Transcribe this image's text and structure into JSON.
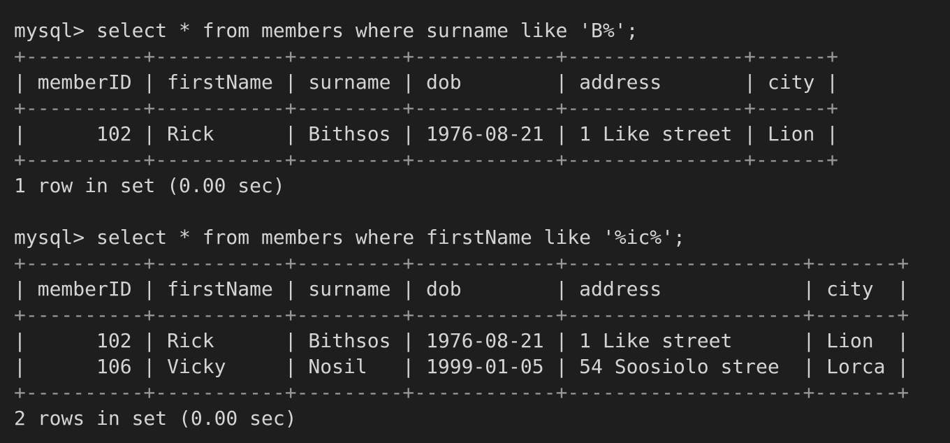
{
  "terminal": {
    "background": "#1e1e1e",
    "text_color": "#d4d4d4",
    "lines": [
      "mysql> select * from members where surname like 'B%';",
      "+----------+-----------+---------+------------+---------------+------+",
      "| memberID | firstName | surname | dob        | address       | city |",
      "+----------+-----------+---------+------------+---------------+------+",
      "|      102 | Rick      | Bithsos | 1976-08-21 | 1 Like street | Lion |",
      "+----------+-----------+---------+------------+---------------+------+",
      "1 row in set (0.00 sec)",
      "",
      "mysql> select * from members where firstName like '%ic%';",
      "+----------+-----------+---------+------------+--------------------+-------+",
      "| memberID | firstName | surname | dob        | address            | city  |",
      "+----------+-----------+---------+------------+--------------------+-------+",
      "|      102 | Rick      | Bithsos | 1976-08-21 | 1 Like street      | Lion  |",
      "|      106 | Vicky     | Nosil   | 1999-01-05 | 54 Soosiolo stree  | Lorca |",
      "+----------+-----------+---------+------------+--------------------+-------+",
      "2 rows in set (0.00 sec)"
    ]
  },
  "queries": [
    {
      "command": "mysql> select * from members where surname like 'B%';",
      "columns": [
        "memberID",
        "firstName",
        "surname",
        "dob",
        "address",
        "city"
      ],
      "rows": [
        [
          "102",
          "Rick",
          "Bithsos",
          "1976-08-21",
          "1 Like street",
          "Lion"
        ]
      ],
      "status": "1 row in set (0.00 sec)"
    },
    {
      "command": "mysql> select * from members where firstName like '%ic%';",
      "columns": [
        "memberID",
        "firstName",
        "surname",
        "dob",
        "address",
        "city"
      ],
      "rows": [
        [
          "102",
          "Rick",
          "Bithsos",
          "1976-08-21",
          "1 Like street",
          "Lion"
        ],
        [
          "106",
          "Vicky",
          "Nosil",
          "1999-01-05",
          "54 Soosiolo stree",
          "Lorca"
        ]
      ],
      "status": "2 rows in set (0.00 sec)"
    }
  ]
}
